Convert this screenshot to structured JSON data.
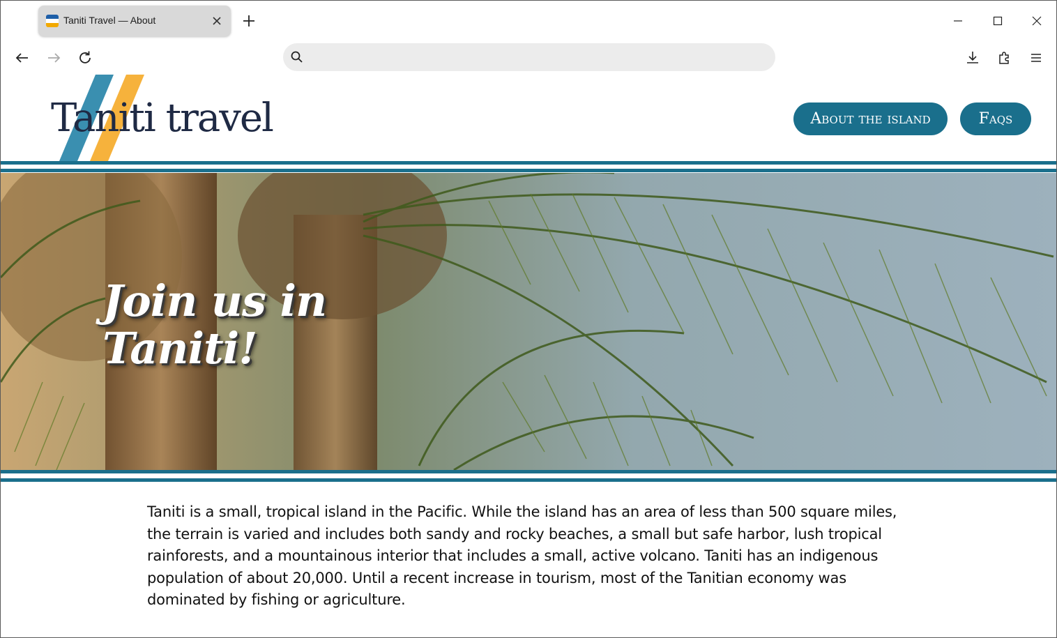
{
  "browser": {
    "tab_title": "Taniti Travel — About",
    "url": "",
    "icons": [
      "tab-favicon",
      "close-icon",
      "plus-icon",
      "minimize-icon",
      "maximize-icon",
      "close-window-icon",
      "back-arrow-icon",
      "forward-arrow-icon",
      "reload-icon",
      "search-icon",
      "download-icon",
      "extensions-icon",
      "menu-icon"
    ]
  },
  "site": {
    "logo": "Taniti travel",
    "nav": {
      "about": "About the island",
      "faqs": "Faqs"
    },
    "hero_title": "Join us in Taniti!",
    "intro": "Taniti is a small, tropical island in the Pacific. While the island has an area of less than 500 square miles, the terrain is varied and includes both sandy and rocky beaches, a small but safe harbor, lush tropical rainforests, and a mountainous interior that includes a small, active volcano. Taniti has an indigenous population of about 20,000. Until a recent increase in tourism, most of the Tanitian economy was dominated by fishing or agriculture."
  },
  "colors": {
    "accent": "#1a6f8c",
    "logo_blue": "#3a8fb0",
    "logo_orange": "#f6b23c"
  }
}
